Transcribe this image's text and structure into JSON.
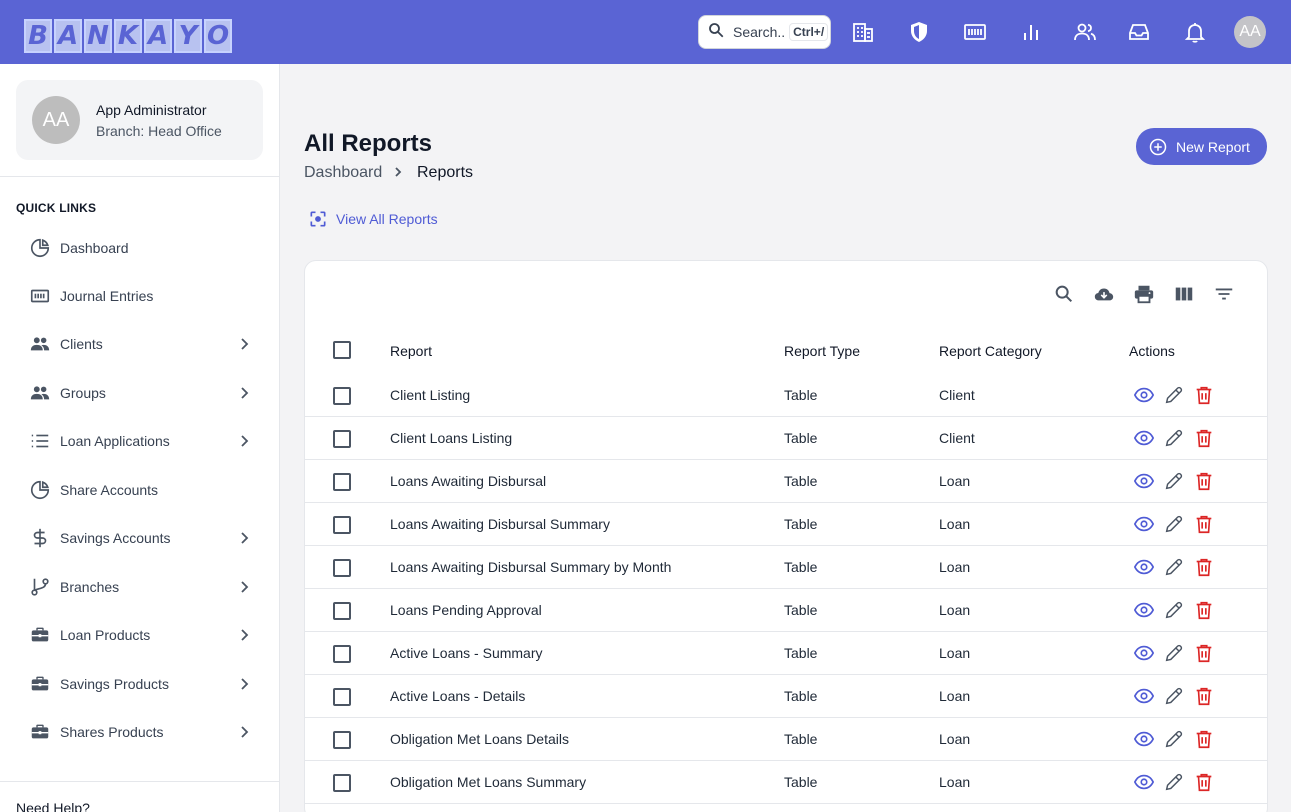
{
  "brand": {
    "letters": [
      "B",
      "A",
      "N",
      "K",
      "A",
      "Y",
      "O"
    ]
  },
  "search": {
    "placeholder": "Search..",
    "shortcut": "Ctrl+/"
  },
  "header": {
    "avatar_initials": "AA"
  },
  "user": {
    "initials": "AA",
    "name": "App Administrator",
    "branch": "Branch: Head Office"
  },
  "sidebar": {
    "heading": "QUICK LINKS",
    "items": [
      {
        "label": "Dashboard",
        "icon": "pie-chart-icon",
        "has_children": false
      },
      {
        "label": "Journal Entries",
        "icon": "ledger-icon",
        "has_children": false
      },
      {
        "label": "Clients",
        "icon": "people-icon",
        "has_children": true
      },
      {
        "label": "Groups",
        "icon": "people-icon",
        "has_children": true
      },
      {
        "label": "Loan Applications",
        "icon": "list-icon",
        "has_children": true
      },
      {
        "label": "Share Accounts",
        "icon": "pie-chart-icon",
        "has_children": false
      },
      {
        "label": "Savings Accounts",
        "icon": "dollar-icon",
        "has_children": true
      },
      {
        "label": "Branches",
        "icon": "branch-icon",
        "has_children": true
      },
      {
        "label": "Loan Products",
        "icon": "briefcase-icon",
        "has_children": true
      },
      {
        "label": "Savings Products",
        "icon": "briefcase-icon",
        "has_children": true
      },
      {
        "label": "Shares Products",
        "icon": "briefcase-icon",
        "has_children": true
      }
    ],
    "footer": "Need Help?"
  },
  "page": {
    "title": "All Reports",
    "breadcrumb": [
      "Dashboard",
      "Reports"
    ],
    "new_button": "New Report",
    "view_all": "View All Reports"
  },
  "table": {
    "columns": [
      "Report",
      "Report Type",
      "Report Category",
      "Actions"
    ],
    "rows": [
      {
        "report": "Client Listing",
        "type": "Table",
        "category": "Client"
      },
      {
        "report": "Client Loans Listing",
        "type": "Table",
        "category": "Client"
      },
      {
        "report": "Loans Awaiting Disbursal",
        "type": "Table",
        "category": "Loan"
      },
      {
        "report": "Loans Awaiting Disbursal Summary",
        "type": "Table",
        "category": "Loan"
      },
      {
        "report": "Loans Awaiting Disbursal Summary by Month",
        "type": "Table",
        "category": "Loan"
      },
      {
        "report": "Loans Pending Approval",
        "type": "Table",
        "category": "Loan"
      },
      {
        "report": "Active Loans - Summary",
        "type": "Table",
        "category": "Loan"
      },
      {
        "report": "Active Loans - Details",
        "type": "Table",
        "category": "Loan"
      },
      {
        "report": "Obligation Met Loans Details",
        "type": "Table",
        "category": "Loan"
      },
      {
        "report": "Obligation Met Loans Summary",
        "type": "Table",
        "category": "Loan"
      }
    ]
  },
  "colors": {
    "primary": "#5a64d4",
    "link": "#4f5bd5",
    "delete": "#dc2626"
  }
}
